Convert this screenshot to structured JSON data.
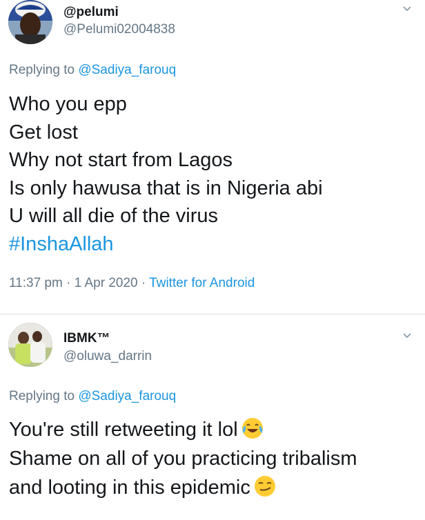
{
  "tweets": [
    {
      "name": "@pelumi",
      "handle": "@Pelumi02004838",
      "replying_prefix": "Replying to",
      "replying_to": "@Sadiya_farouq",
      "lines": [
        "Who you epp",
        "Get lost",
        "Why not start from Lagos",
        "Is only hawusa that is in Nigeria abi",
        "U will all die of the virus"
      ],
      "hashtag": "#InshaAllah",
      "time": "11:37 pm",
      "date": "1 Apr 2020",
      "client": "Twitter for Android",
      "avatar_icon": "user-avatar-photo"
    },
    {
      "name": "IBMK™",
      "handle": "@oluwa_darrin",
      "replying_prefix": "Replying to",
      "replying_to": "@Sadiya_farouq",
      "lines": [
        "You're still retweeting it lol",
        "Shame on all of you practicing tribalism",
        "and looting in this epidemic"
      ],
      "emojis": [
        "tears-of-joy-emoji",
        "smirk-emoji"
      ],
      "avatar_icon": "user-avatar-photo"
    }
  ],
  "icons": {
    "more": "chevron-down-icon"
  },
  "colors": {
    "link": "#1b95e0",
    "secondary_text": "#657786",
    "primary_text": "#14171a",
    "divider": "#dbe0e4"
  }
}
